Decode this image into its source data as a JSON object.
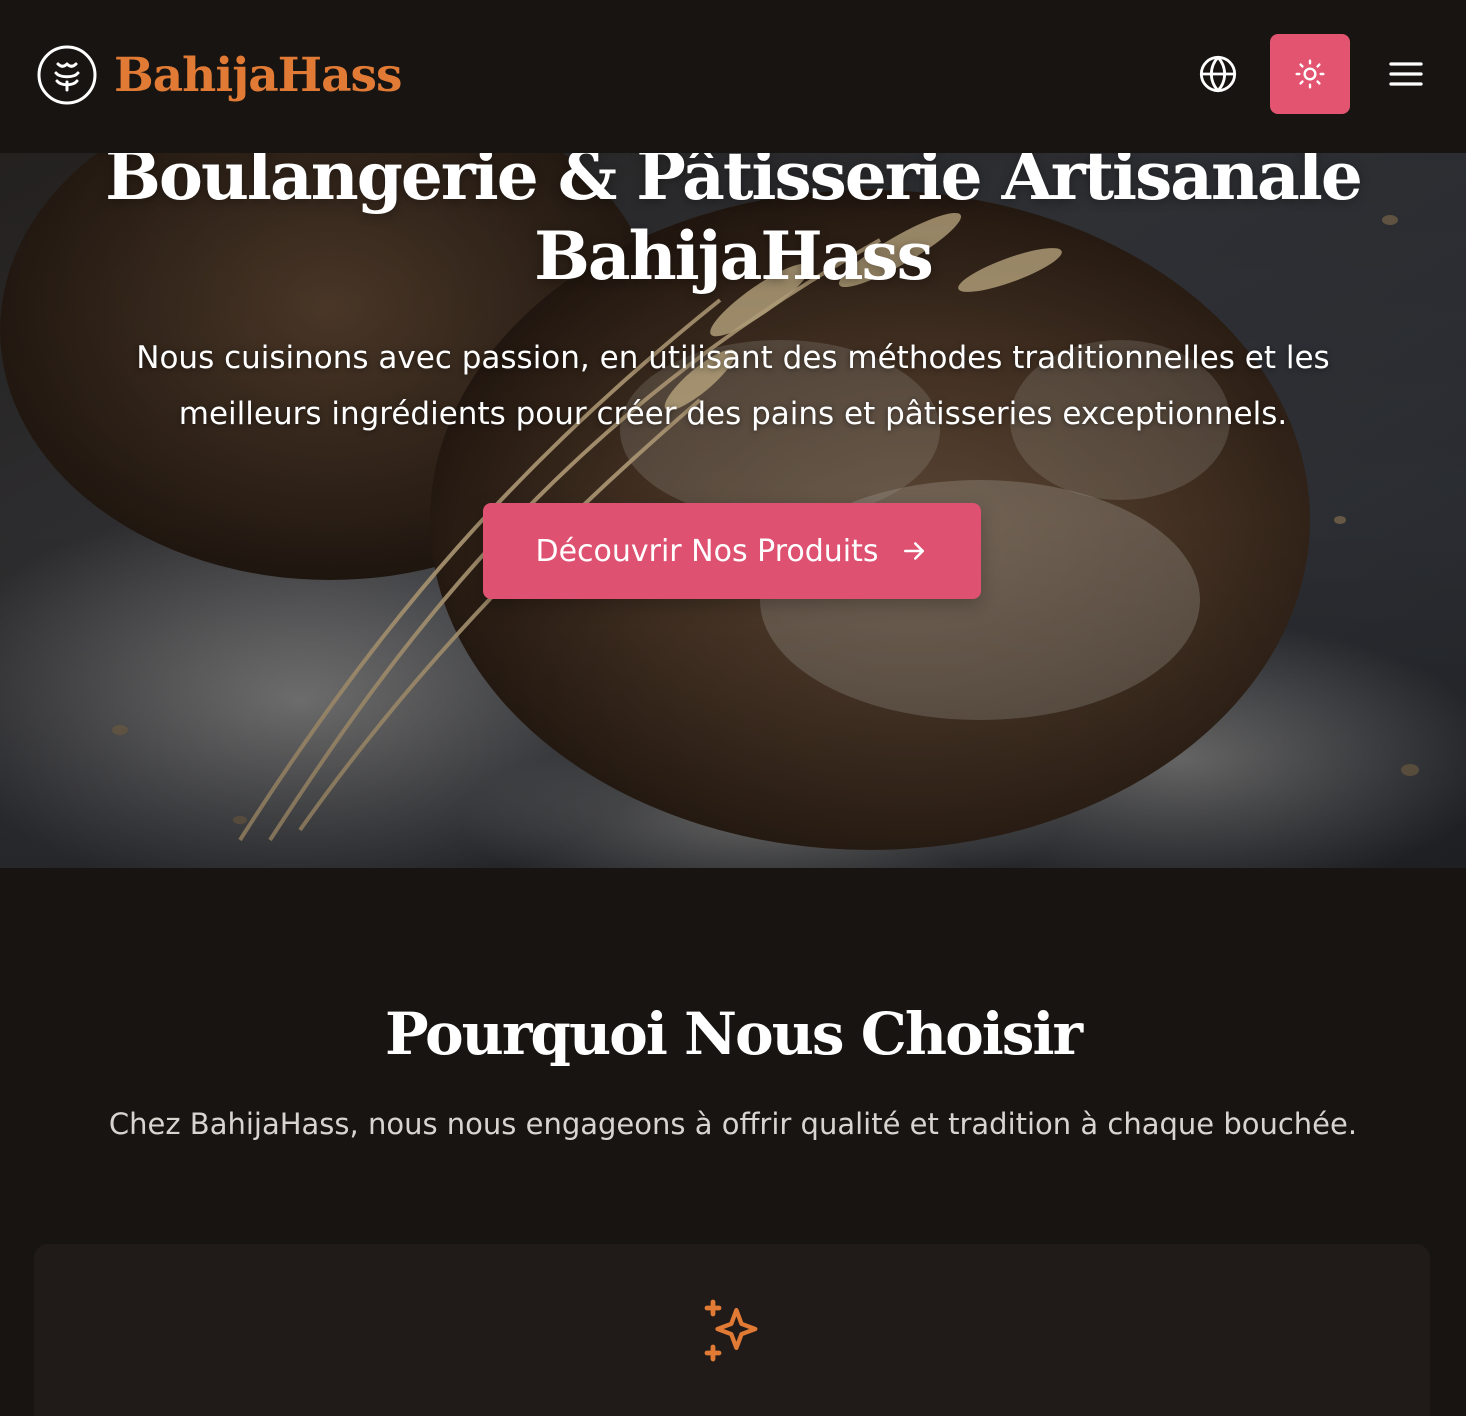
{
  "header": {
    "brand_name": "BahijaHass",
    "icons": {
      "logo": "wheat-smile-logo-icon",
      "language": "globe-icon",
      "theme": "sun-icon",
      "menu": "hamburger-menu-icon"
    }
  },
  "hero": {
    "title_line1": "Boulangerie & Pâtisserie Artisanale",
    "title_line2": "BahijaHass",
    "subtitle": "Nous cuisinons avec passion, en utilisant des méthodes traditionnelles et les meilleurs ingrédients pour créer des pains et pâtisseries exceptionnels.",
    "cta_label": "Découvrir Nos Produits",
    "cta_icon": "arrow-right-icon",
    "background_image": "bread-loaf-with-wheat-photo"
  },
  "why": {
    "title": "Pourquoi Nous Choisir",
    "subtitle": "Chez BahijaHass, nous nous engageons à offrir qualité et tradition à chaque bouchée.",
    "feature_icon": "sparkles-icon"
  },
  "colors": {
    "background": "#181412",
    "card": "#201b18",
    "brand_orange": "#e07a34",
    "accent_pink": "#de5170",
    "text_white": "#ffffff",
    "text_muted": "#d9d4cf"
  }
}
